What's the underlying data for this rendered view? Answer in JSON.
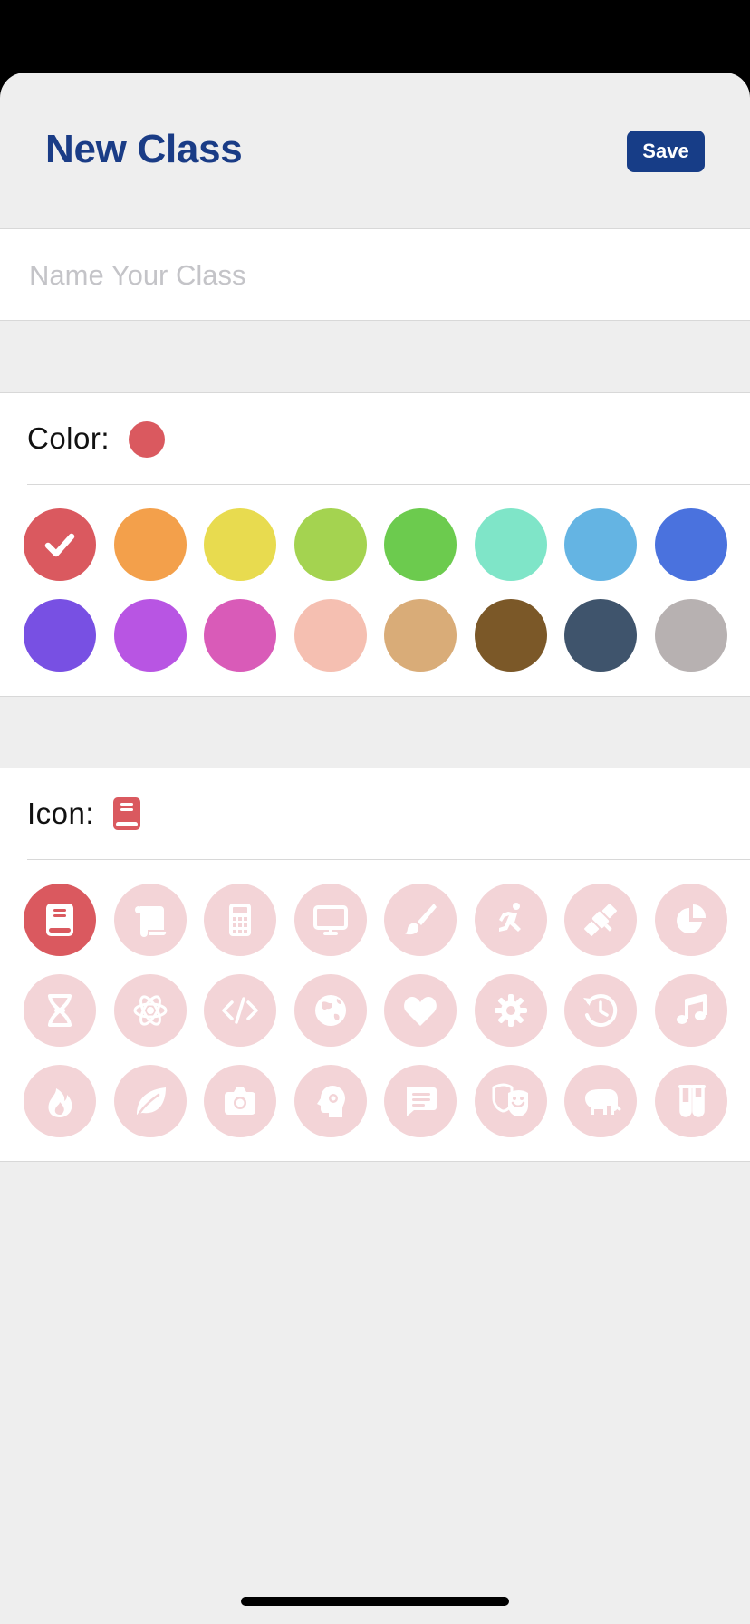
{
  "header": {
    "title": "New Class",
    "save_label": "Save"
  },
  "name_field": {
    "placeholder": "Name Your Class",
    "value": ""
  },
  "color": {
    "label": "Color:",
    "selected_index": 0,
    "options": [
      "#da595f",
      "#f3a04b",
      "#e8db4f",
      "#a4d350",
      "#6ccb4e",
      "#7fe5c8",
      "#64b4e3",
      "#4a72de",
      "#7850e3",
      "#b855e3",
      "#d95bb8",
      "#f5bfb1",
      "#d9ac78",
      "#7b5828",
      "#3f546c",
      "#b7b1b1"
    ]
  },
  "icon": {
    "label": "Icon:",
    "selected_index": 0,
    "selected_color": "#da595f",
    "unselected_background": "#f3d4d7",
    "options": [
      "book-icon",
      "scroll-icon",
      "calculator-icon",
      "monitor-icon",
      "paintbrush-icon",
      "running-icon",
      "satellite-icon",
      "pie-chart-icon",
      "dna-icon",
      "atom-icon",
      "code-icon",
      "globe-icon",
      "heart-icon",
      "gear-icon",
      "history-icon",
      "music-icon",
      "flame-icon",
      "leaf-icon",
      "camera-icon",
      "brain-icon",
      "chat-icon",
      "theater-masks-icon",
      "elephant-icon",
      "test-tubes-icon"
    ]
  }
}
